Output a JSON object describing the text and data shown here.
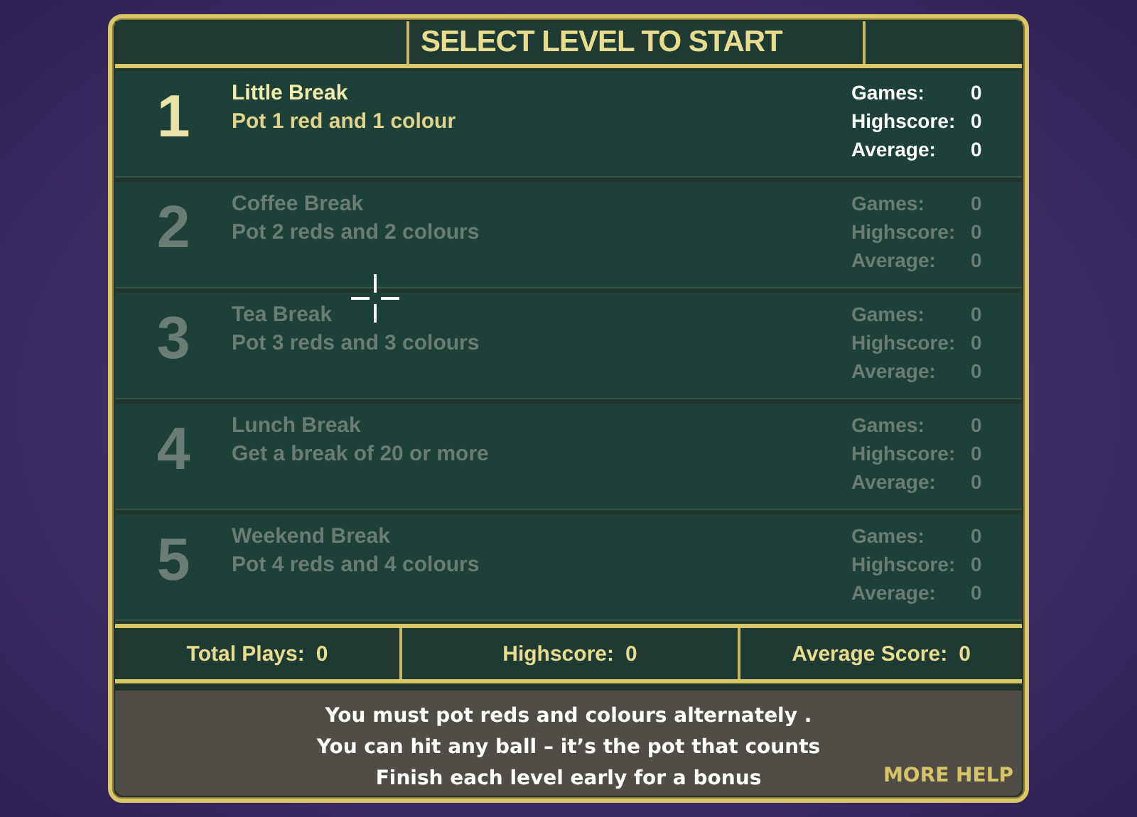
{
  "title": "SELECT LEVEL TO START",
  "levels": [
    {
      "number": "1",
      "name": "Little Break",
      "goal": "Pot 1 red and 1 colour",
      "locked": false,
      "stats": [
        {
          "label": "Games:",
          "value": "0"
        },
        {
          "label": "Highscore:",
          "value": "0"
        },
        {
          "label": "Average:",
          "value": "0"
        }
      ]
    },
    {
      "number": "2",
      "name": "Coffee Break",
      "goal": "Pot 2 reds and 2 colours",
      "locked": true,
      "stats": [
        {
          "label": "Games:",
          "value": "0"
        },
        {
          "label": "Highscore:",
          "value": "0"
        },
        {
          "label": "Average:",
          "value": "0"
        }
      ]
    },
    {
      "number": "3",
      "name": "Tea Break",
      "goal": "Pot 3 reds and 3 colours",
      "locked": true,
      "stats": [
        {
          "label": "Games:",
          "value": "0"
        },
        {
          "label": "Highscore:",
          "value": "0"
        },
        {
          "label": "Average:",
          "value": "0"
        }
      ]
    },
    {
      "number": "4",
      "name": "Lunch Break",
      "goal": "Get a break of 20 or more",
      "locked": true,
      "stats": [
        {
          "label": "Games:",
          "value": "0"
        },
        {
          "label": "Highscore:",
          "value": "0"
        },
        {
          "label": "Average:",
          "value": "0"
        }
      ]
    },
    {
      "number": "5",
      "name": "Weekend Break",
      "goal": "Pot 4 reds and 4 colours",
      "locked": true,
      "stats": [
        {
          "label": "Games:",
          "value": "0"
        },
        {
          "label": "Highscore:",
          "value": "0"
        },
        {
          "label": "Average:",
          "value": "0"
        }
      ]
    }
  ],
  "totals": [
    {
      "label": "Total Plays:",
      "value": "0"
    },
    {
      "label": "Highscore:",
      "value": "0"
    },
    {
      "label": "Average Score:",
      "value": "0"
    }
  ],
  "help_lines": [
    "You must pot reds and colours alternately .",
    "You can hit any ball – it’s the pot that counts",
    "Finish each level early for a bonus"
  ],
  "more_help": "MORE HELP"
}
